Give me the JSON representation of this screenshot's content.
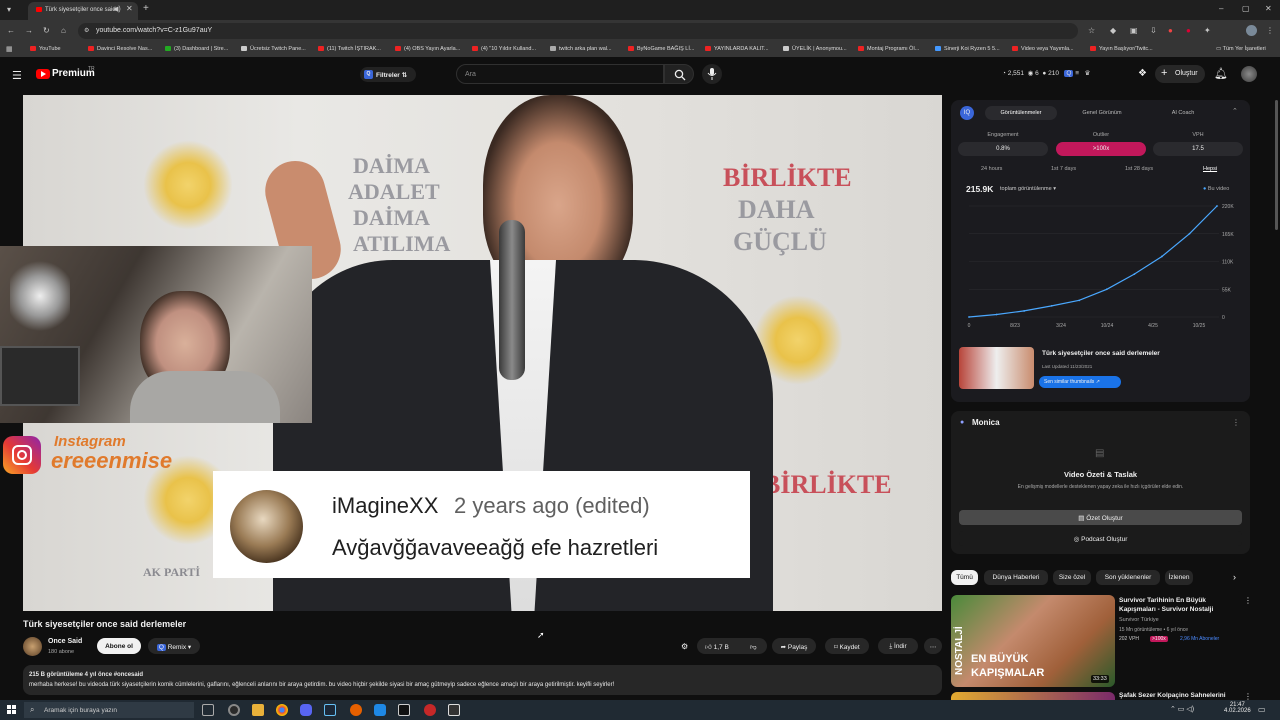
{
  "browser": {
    "tab_title": "Türk siyesetçiler once said",
    "url": "youtube.com/watch?v=C-z1Gu97auY",
    "bookmarks": [
      "YouTube",
      "Davinci Resolve Nas...",
      "(3) Dashboard | Stre...",
      "Ücretsiz Twitch Pane...",
      "(11) Twitch İŞTIRAK...",
      "(4) OBS Yayın Ayarla...",
      "(4) \"10 Yıldır Kulland...",
      "twitch arka plan wal...",
      "ByNoGame BAĞIŞ Lİ...",
      "YAYINLARDA KALIT...",
      "ÜYELİK | Anonymou...",
      "Montaj Programı Öl...",
      "Sinerji Koi Ryzen 5 5...",
      "Video veya Yayımla...",
      "Yayın Başlıyor/Twitc..."
    ],
    "all_bookmarks": "Tüm Yer İşaretleri"
  },
  "youtube": {
    "logo": "Premium",
    "logo_region": "TR",
    "filters": "Filtreler",
    "search_placeholder": "Ara",
    "stat_views": "2,551",
    "stat_count": "6",
    "stat_other": "210",
    "create": "Oluştur"
  },
  "video": {
    "sign_texts": [
      "DAİMA",
      "ADALET",
      "DAİMA",
      "ATILIMA",
      "BİRLİKTE",
      "DAHA",
      "GÜÇLÜ",
      "AK PARTİ"
    ],
    "comment_user": "iMagineXX",
    "comment_time": "2 years ago (edited)",
    "comment_text": "Avğavğğavaveeağğ efe hazretleri",
    "insta_label": "Instagram",
    "insta_handle": "ereeenmise",
    "title": "Türk siyesetçiler once said derlemeler",
    "channel": "Once Said",
    "subs": "180 abone",
    "subscribe": "Abone ol",
    "remix": "Remix",
    "likes": "1,7 B",
    "share": "Paylaş",
    "save": "Kaydet",
    "download": "İndir",
    "desc_meta": "215 B görüntüleme  4 yıl önce  #oncesaid",
    "desc_text": "merhaba herkese! bu videoda türk siyasetçilerin komik cümlelerini, gaflarını, eğlenceli anlarını bir araya getirdim. bu video hiçbir şekilde siyasi bir amaç gütmeyip sadece eğlence amaçlı bir araya getirilmiştir. keyifli seyirler!"
  },
  "vidiq": {
    "tabs": [
      "Görüntülenmeler",
      "Genel Görünüm",
      "AI Coach"
    ],
    "metric_labels": [
      "Engagement",
      "Outlier",
      "VPH"
    ],
    "metric_values": [
      "0.8%",
      ">100x",
      "17.5"
    ],
    "ranges": [
      "24 hours",
      "1st 7 days",
      "1st 28 days",
      "Hepsi"
    ],
    "total": "215.9K",
    "total_label": "toplam görüntülenme",
    "legend": "Bu video",
    "similar_title": "Türk siyesetçiler once said derlemeler",
    "similar_meta": "Last Updated 11/23/2021",
    "similar_btn": "Sen similar thumbnails",
    "accent": "#c2185b"
  },
  "chart_data": {
    "type": "line",
    "x": [
      "0",
      "8/23",
      "3/24",
      "10/24",
      "4/25",
      "10/25"
    ],
    "values": [
      0,
      5,
      12,
      22,
      33,
      55,
      85,
      120,
      165,
      220
    ],
    "series": [
      {
        "name": "Bu video",
        "values": [
          0,
          5,
          12,
          22,
          33,
          55,
          85,
          120,
          165,
          220
        ]
      }
    ],
    "yticks": [
      "220K",
      "165K",
      "110K",
      "55K",
      "0"
    ],
    "ylim": [
      0,
      220
    ]
  },
  "monica": {
    "title": "Monica",
    "heading": "Video Özeti & Taslak",
    "sub": "En gelişmiş modellerle desteklenen yapay zeka ile hızlı içgörüler elde edin.",
    "btn_summary": "Özet Oluştur",
    "btn_podcast": "Podcast Oluştur"
  },
  "chips": [
    "Tümü",
    "Dünya Haberleri",
    "Size özel",
    "Son yüklenenler",
    "İzlenen"
  ],
  "rec": {
    "title": "Survivor Tarihinin En Büyük Kapışmaları - Survivor Nostalji",
    "channel": "Survivor Türkiye",
    "meta": "15 Mn görüntüleme • 6 yıl önce",
    "badge1": "202 VPH",
    "badge2": ">100x",
    "badge3": "2,96 Mn Aboneler",
    "thumb_text1": "NOSTALJİ",
    "thumb_text2": "EN BÜYÜK",
    "thumb_text3": "KAPIŞMALAR",
    "duration": "33:33",
    "next_title": "Şafak Sezer Kolpaçino Sahnelerini"
  },
  "taskbar": {
    "search": "Aramak için buraya yazın",
    "time": "21:47",
    "date": "4.02.2026"
  }
}
